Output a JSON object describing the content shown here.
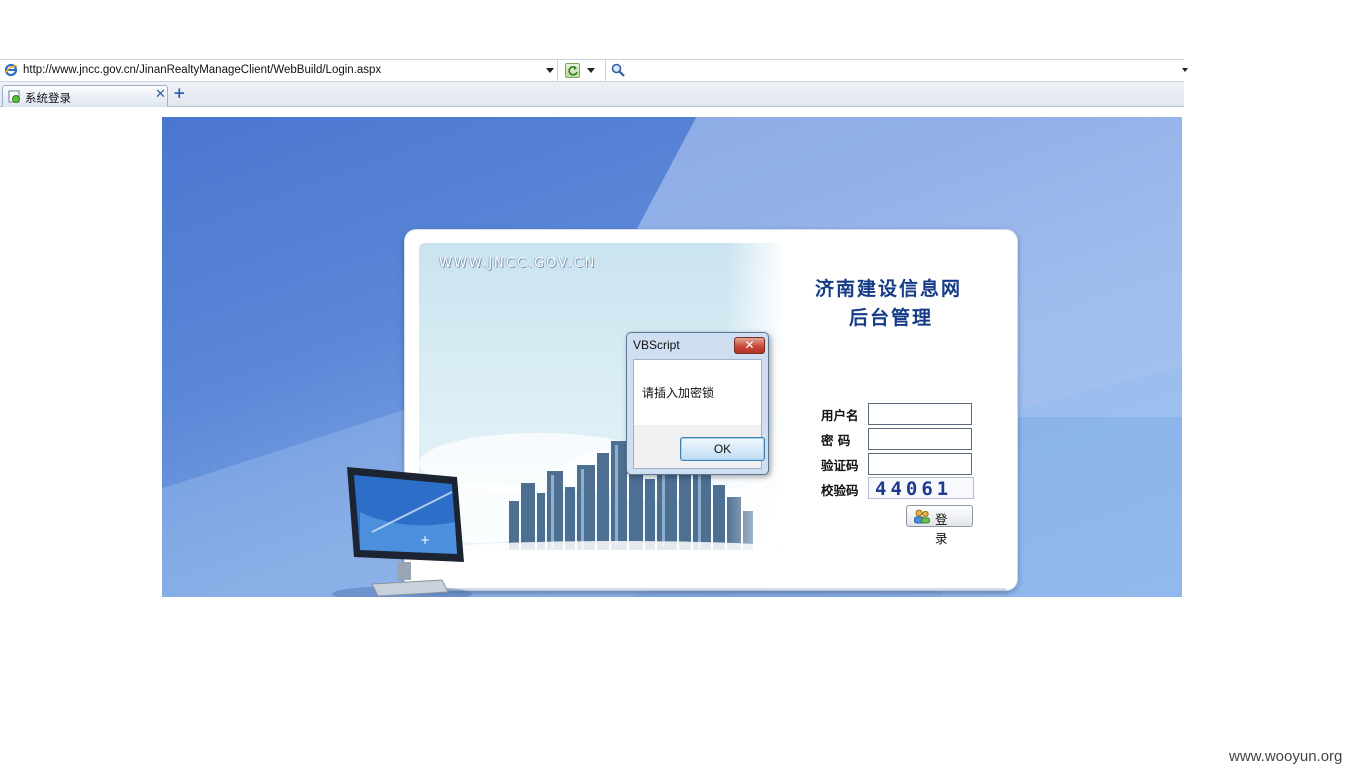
{
  "browser": {
    "url": "http://www.jncc.gov.cn/JinanRealtyManageClient/WebBuild/Login.aspx",
    "search_placeholder": "",
    "tabs": [
      {
        "label": "系统登录"
      }
    ]
  },
  "page": {
    "site_text": "WWW.JNCC.GOV.CN",
    "title_line1": "济南建设信息网",
    "title_line2": "后台管理",
    "form": {
      "username_label": "用户名",
      "password_label": "密 码",
      "verify_label": "验证码",
      "check_label": "校验码",
      "username_value": "",
      "password_value": "",
      "verify_value": "",
      "captcha_code": "44061",
      "login_label": "登 录"
    }
  },
  "dialog": {
    "title": "VBScript",
    "message": "请插入加密锁",
    "ok_label": "OK"
  },
  "watermark": "www.wooyun.org",
  "colors": {
    "title": "#163c88",
    "background_blue": "#5c88d8",
    "dialog_close": "#c94a3a"
  }
}
